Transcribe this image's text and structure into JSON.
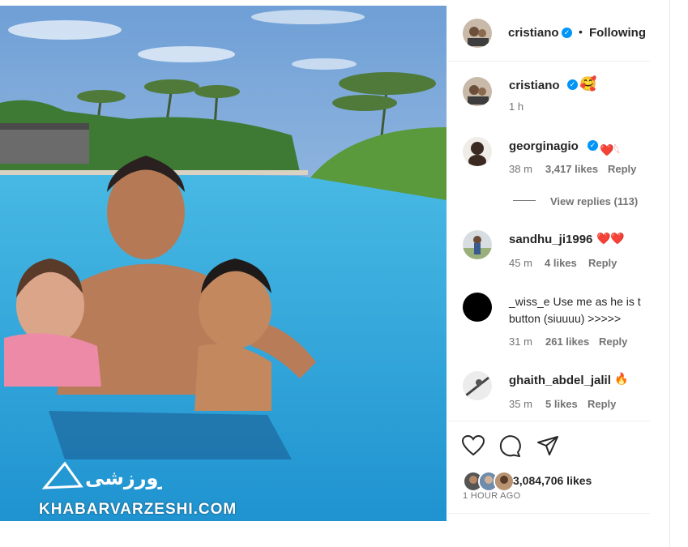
{
  "post": {
    "author": "cristiano",
    "follow_separator": "•",
    "follow_state": "Following"
  },
  "caption": {
    "author": "cristiano",
    "emoji": "🥰",
    "time": "1 h"
  },
  "comments": [
    {
      "user": "georginagio",
      "verified": true,
      "text": "❤️𓆩",
      "time": "38 m",
      "likes": "3,417 likes",
      "reply": "Reply"
    },
    {
      "user": "sandhu_ji1996",
      "verified": false,
      "text": "❤️❤️",
      "time": "45 m",
      "likes": "4 likes",
      "reply": "Reply"
    },
    {
      "user": "_wiss_e",
      "verified": false,
      "text": "Use me as he is t",
      "text2": "button (siuuuu) >>>>>",
      "time": "31 m",
      "likes": "261 likes",
      "reply": "Reply"
    },
    {
      "user": "ghaith_abdel_jalil",
      "verified": false,
      "text": "🔥",
      "time": "35 m",
      "likes": "5 likes",
      "reply": "Reply"
    }
  ],
  "view_replies": "View replies (113)",
  "likes_count": "3,084,706 likes",
  "posted_ago": "1 HOUR AGO",
  "watermark": "KHABARVARZESHI.COM",
  "watermark_logo": "خبرورزشی",
  "verified_glyph": "✓",
  "colors": {
    "accent": "#0095f6",
    "text": "#262626",
    "muted": "#737373",
    "heart": "#ed4956"
  }
}
